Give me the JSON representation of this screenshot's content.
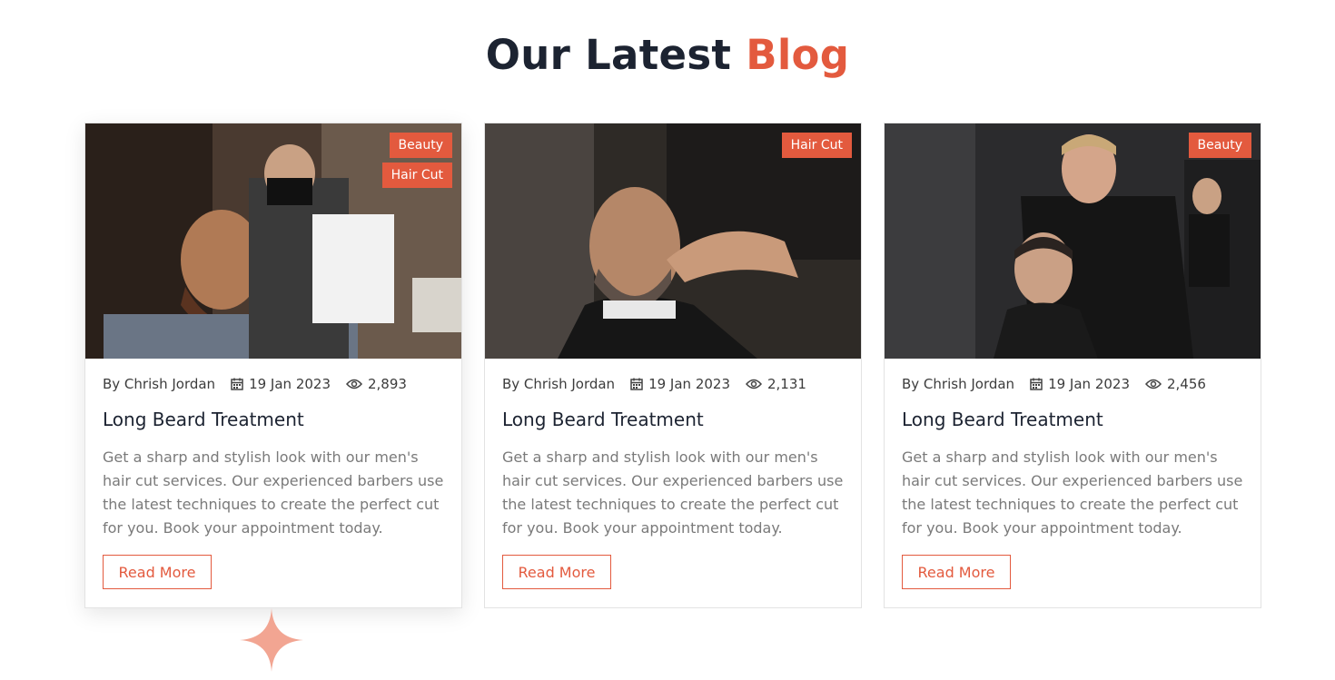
{
  "heading": {
    "part1": "Our Latest",
    "part2": "Blog"
  },
  "colors": {
    "accent": "#e35a3e",
    "dark": "#1c2331",
    "muted": "#7a7a7a"
  },
  "posts": [
    {
      "tags": [
        "Beauty",
        "Hair Cut"
      ],
      "author": "By Chrish Jordan",
      "date": "19 Jan 2023",
      "views": "2,893",
      "title": "Long Beard Treatment",
      "description": "Get a sharp and stylish look with our men's hair cut services. Our experienced barbers use the latest techniques to create the perfect cut for you. Book your appointment today.",
      "button": "Read More"
    },
    {
      "tags": [
        "Hair Cut"
      ],
      "author": "By Chrish Jordan",
      "date": "19 Jan 2023",
      "views": "2,131",
      "title": "Long Beard Treatment",
      "description": "Get a sharp and stylish look with our men's hair cut services. Our experienced barbers use the latest techniques to create the perfect cut for you. Book your appointment today.",
      "button": "Read More"
    },
    {
      "tags": [
        "Beauty"
      ],
      "author": "By Chrish Jordan",
      "date": "19 Jan 2023",
      "views": "2,456",
      "title": "Long Beard Treatment",
      "description": "Get a sharp and stylish look with our men's hair cut services. Our experienced barbers use the latest techniques to create the perfect cut for you. Book your appointment today.",
      "button": "Read More"
    }
  ],
  "icons": {
    "date": "calendar-icon",
    "views": "eye-icon",
    "decoration": "sparkle-icon"
  }
}
